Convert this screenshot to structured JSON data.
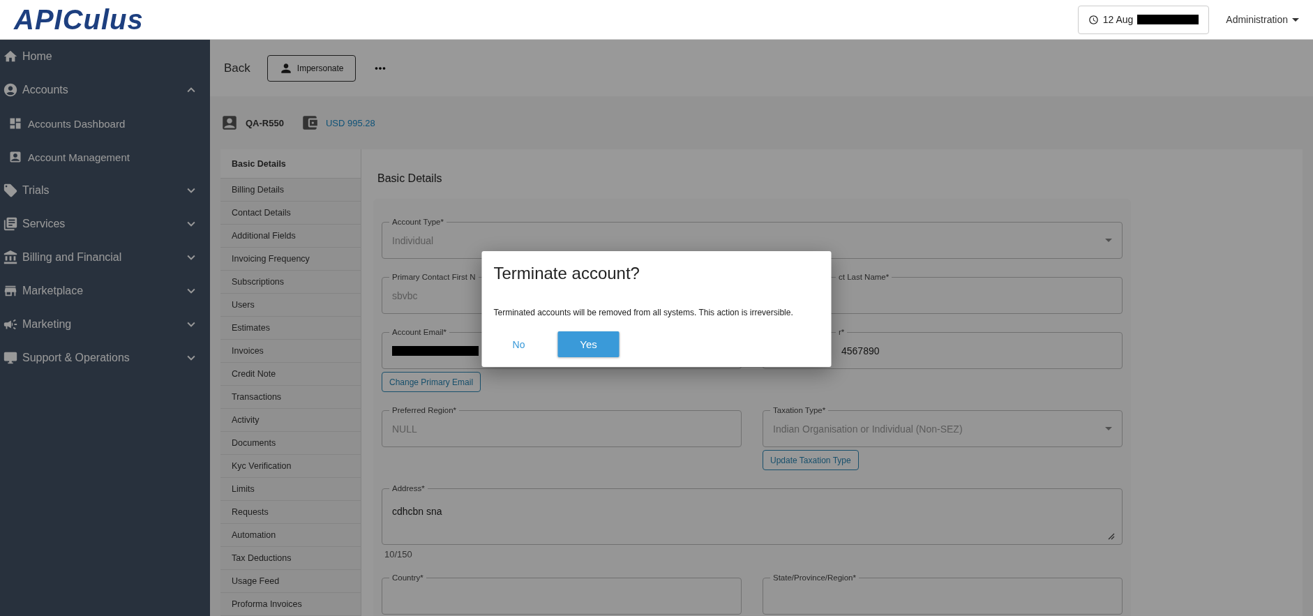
{
  "header": {
    "logo": "APICulus",
    "date": {
      "text": "12 Aug",
      "redacted": true
    },
    "menu": "Administration"
  },
  "sidebar": {
    "items": [
      {
        "label": "Home"
      },
      {
        "label": "Accounts",
        "expanded": true,
        "children": [
          {
            "label": "Accounts Dashboard"
          },
          {
            "label": "Account Management"
          }
        ]
      },
      {
        "label": "Trials",
        "expanded": false
      },
      {
        "label": "Services",
        "expanded": false
      },
      {
        "label": "Billing and Financial",
        "expanded": false
      },
      {
        "label": "Marketplace",
        "expanded": false
      },
      {
        "label": "Marketing",
        "expanded": false
      },
      {
        "label": "Support & Operations",
        "expanded": false
      }
    ]
  },
  "toolbar": {
    "back": "Back",
    "impersonate": "Impersonate"
  },
  "account": {
    "id": "QA-R550",
    "balance": "USD 995.28"
  },
  "tabs": [
    {
      "label": "Basic Details",
      "selected": true
    },
    {
      "label": "Billing Details",
      "selected": false
    },
    {
      "label": "Contact Details",
      "selected": false
    },
    {
      "label": "Additional Fields",
      "selected": false
    },
    {
      "label": "Invoicing Frequency",
      "selected": false
    },
    {
      "label": "Subscriptions",
      "selected": false
    },
    {
      "label": "Users",
      "selected": false
    },
    {
      "label": "Estimates",
      "selected": false
    },
    {
      "label": "Invoices",
      "selected": false
    },
    {
      "label": "Credit Note",
      "selected": false
    },
    {
      "label": "Transactions",
      "selected": false
    },
    {
      "label": "Activity",
      "selected": false
    },
    {
      "label": "Documents",
      "selected": false
    },
    {
      "label": "Kyc Verification",
      "selected": false
    },
    {
      "label": "Limits",
      "selected": false
    },
    {
      "label": "Requests",
      "selected": false
    },
    {
      "label": "Automation",
      "selected": false
    },
    {
      "label": "Tax Deductions",
      "selected": false
    },
    {
      "label": "Usage Feed",
      "selected": false
    },
    {
      "label": "Proforma Invoices",
      "selected": false
    }
  ],
  "form": {
    "title": "Basic Details",
    "rows": [
      [
        {
          "kind": "select",
          "label": "Account Type*",
          "value": "Individual",
          "disabled": true
        }
      ],
      [
        {
          "kind": "text",
          "label": "Primary Contact First N",
          "value": "sbvbc",
          "disabled": true
        },
        {
          "kind": "text",
          "label": "ct Last Name*",
          "obscured": true
        }
      ],
      [
        {
          "kind": "text",
          "label": "Account Email*",
          "redacted": true,
          "action": "Change Primary Email"
        },
        {
          "kind": "text",
          "label": "r*",
          "value": "4567890",
          "disabled": false,
          "obscured": true
        }
      ],
      [
        {
          "kind": "text",
          "label": "Preferred Region*",
          "value": "NULL",
          "disabled": true
        },
        {
          "kind": "select",
          "label": "Taxation Type*",
          "value": "Indian Organisation or Individual (Non-SEZ)",
          "disabled": true,
          "action": "Update Taxation Type"
        }
      ],
      [
        {
          "kind": "textarea",
          "label": "Address*",
          "value": "cdhcbn sna",
          "disabled": false,
          "counter": "10/150"
        }
      ],
      [
        {
          "kind": "text",
          "label": "Country*"
        },
        {
          "kind": "text",
          "label": "State/Province/Region*"
        }
      ]
    ]
  },
  "dialog": {
    "title": "Terminate account?",
    "message": "Terminated accounts will be removed from all systems. This action is irreversible.",
    "cancel": "No",
    "confirm": "Yes"
  }
}
